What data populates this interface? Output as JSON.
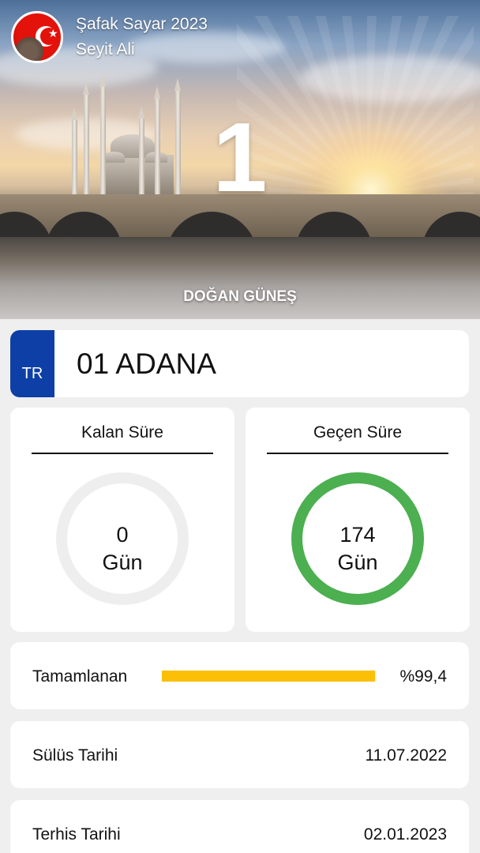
{
  "header": {
    "app_title": "Şafak Sayar 2023",
    "user_name": "Seyit Ali",
    "big_number": "1",
    "caption": "DOĞAN GÜNEŞ"
  },
  "plate": {
    "country_code": "TR",
    "text": "01 ADANA",
    "band_color": "#0d3fa6"
  },
  "stats": {
    "remaining": {
      "title": "Kalan Süre",
      "value": "0",
      "unit": "Gün",
      "ring_color": "#eeeeee",
      "fraction": 0
    },
    "elapsed": {
      "title": "Geçen Süre",
      "value": "174",
      "unit": "Gün",
      "ring_color": "#4caf50",
      "fraction": 1
    }
  },
  "progress": {
    "label": "Tamamlanan",
    "value_text": "%99,4",
    "fraction": 0.994,
    "color": "#fbbf07"
  },
  "dates": {
    "sulus_label": "Sülüs Tarihi",
    "sulus_value": "11.07.2022",
    "terhis_label": "Terhis Tarihi",
    "terhis_value": "02.01.2023"
  },
  "icons": {
    "avatar": "turkish-flag-soldier-avatar"
  }
}
